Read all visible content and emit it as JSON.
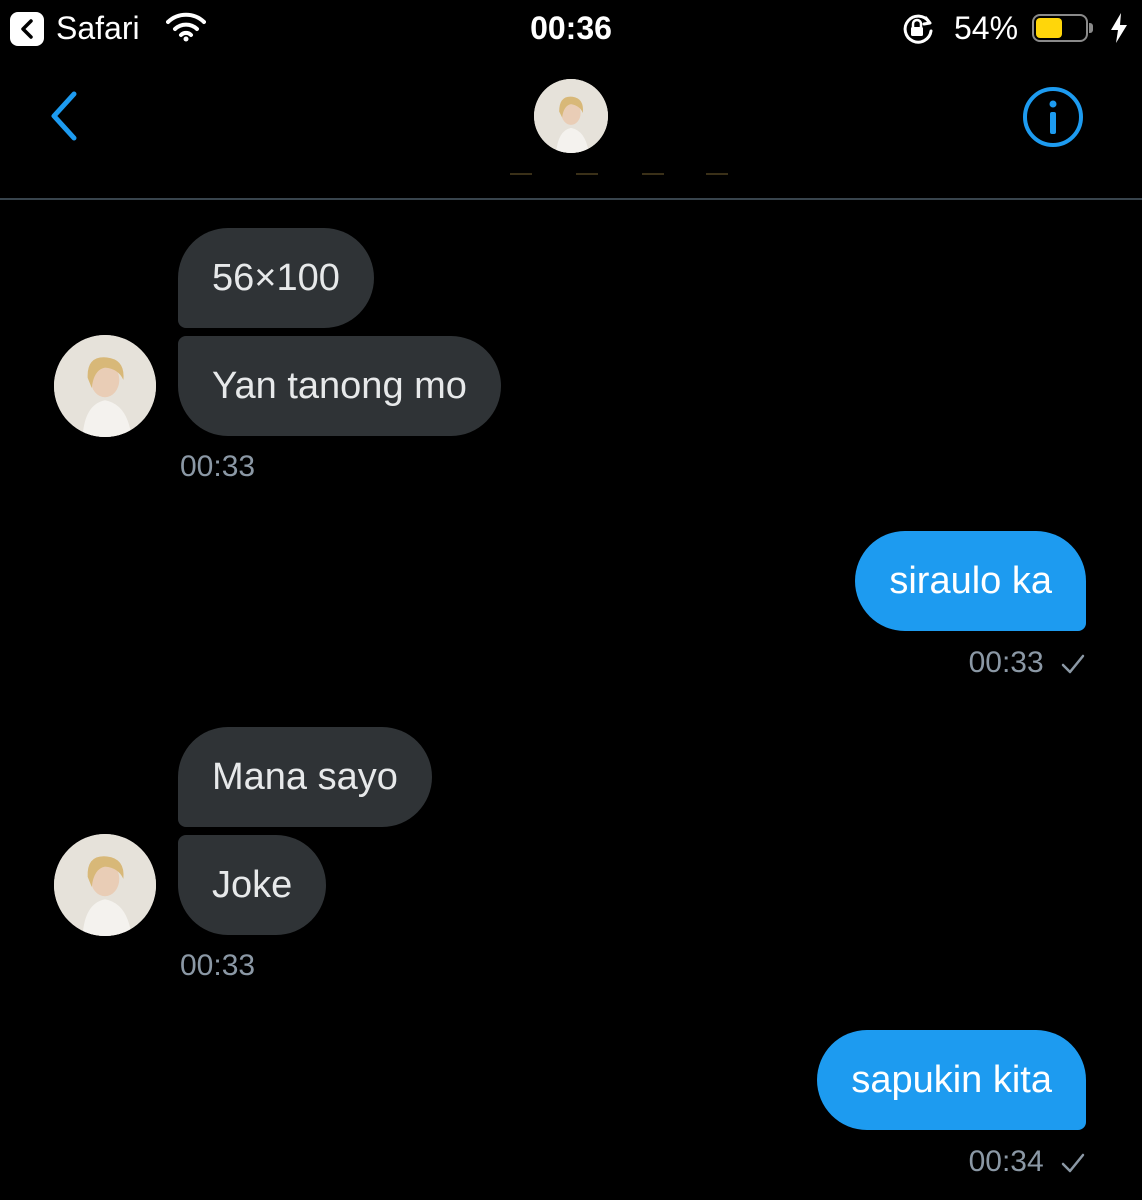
{
  "status_bar": {
    "back_app": "Safari",
    "time": "00:36",
    "battery": "54%",
    "battery_level": 0.54,
    "battery_color": "#ffd60a"
  },
  "header": {
    "back_icon": "chevron-left-icon",
    "info_icon": "info-icon"
  },
  "colors": {
    "accent": "#1d9bf0",
    "incoming_bubble": "#2f3336",
    "timestamp": "#8b98a5"
  },
  "messages": [
    {
      "direction": "in",
      "texts": [
        "56×100",
        "Yan tanong mo"
      ],
      "time": "00:33"
    },
    {
      "direction": "out",
      "texts": [
        "siraulo ka"
      ],
      "time": "00:33",
      "status_icon": "check-icon"
    },
    {
      "direction": "in",
      "texts": [
        "Mana sayo",
        "Joke"
      ],
      "time": "00:33"
    },
    {
      "direction": "out",
      "texts": [
        "sapukin kita"
      ],
      "time": "00:34",
      "status_icon": "check-icon"
    }
  ]
}
